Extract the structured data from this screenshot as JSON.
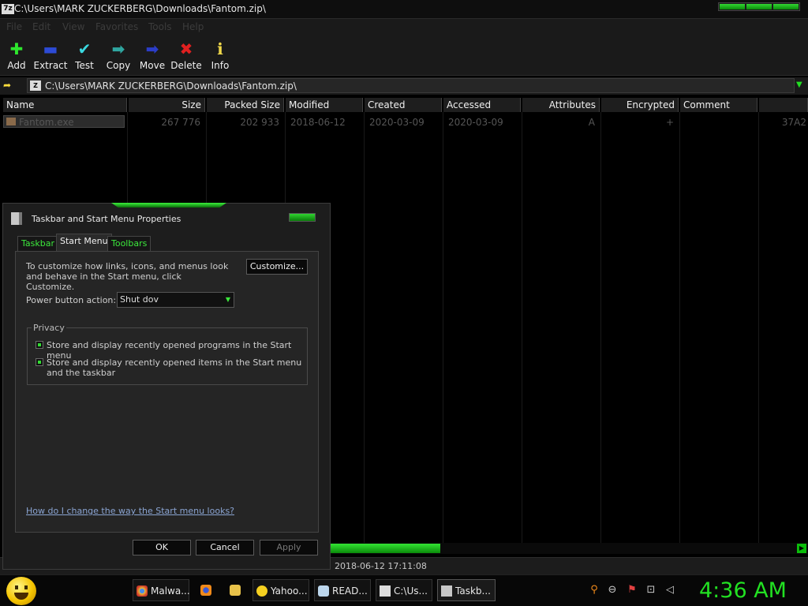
{
  "window": {
    "app_icon_text": "7z",
    "title": "C:\\Users\\MARK ZUCKERBERG\\Downloads\\Fantom.zip\\"
  },
  "menu": [
    "File",
    "Edit",
    "View",
    "Favorites",
    "Tools",
    "Help"
  ],
  "toolbar": {
    "add": "Add",
    "extract": "Extract",
    "test": "Test",
    "copy": "Copy",
    "move": "Move",
    "delete": "Delete",
    "info": "Info"
  },
  "address": {
    "zip_icon_text": "Z",
    "path": "C:\\Users\\MARK ZUCKERBERG\\Downloads\\Fantom.zip\\"
  },
  "columns": [
    "Name",
    "Size",
    "Packed Size",
    "Modified",
    "Created",
    "Accessed",
    "Attributes",
    "Encrypted",
    "Comment"
  ],
  "files": [
    {
      "name": "Fantom.exe",
      "size": "267 776",
      "packed_size": "202 933",
      "modified": "2018-06-12",
      "created": "2020-03-09",
      "accessed": "2020-03-09",
      "attributes": "A",
      "encrypted": "+",
      "comment": "",
      "crc": "37A2"
    }
  ],
  "status": {
    "modified_time": "2018-06-12 17:11:08"
  },
  "dialog": {
    "title": "Taskbar and Start Menu Properties",
    "tabs": [
      "Taskbar",
      "Start Menu",
      "Toolbars"
    ],
    "active_tab": "Start Menu",
    "description": "To customize how links, icons, and menus look and behave in the Start menu, click Customize.",
    "customize_button": "Customize...",
    "power_label": "Power button action:",
    "power_value": "Shut dov",
    "privacy_label": "Privacy",
    "privacy_options": [
      {
        "label": "Store and display recently opened programs in the Start menu",
        "checked": true
      },
      {
        "label": "Store and display recently opened items in the Start menu and the taskbar",
        "checked": true
      }
    ],
    "help_link": "How do I change the way the Start menu looks?",
    "ok": "OK",
    "cancel": "Cancel",
    "apply": "Apply"
  },
  "taskbar": {
    "tasks": [
      {
        "label": "Malwa...",
        "icon": "chrome-icon"
      },
      {
        "label": "",
        "icon": "firefox-icon"
      },
      {
        "label": "",
        "icon": "folder-icon"
      },
      {
        "label": "Yahoo...",
        "icon": "yahoo-messenger-icon"
      },
      {
        "label": "READ...",
        "icon": "notepad-icon"
      },
      {
        "label": "C:\\Us...",
        "icon": "7zip-icon"
      },
      {
        "label": "Taskb...",
        "icon": "taskbar-properties-icon"
      }
    ],
    "tray_icons": [
      "search-icon",
      "messenger-icon",
      "action-center-flag-icon",
      "network-icon",
      "volume-icon"
    ],
    "clock": "4:36 AM"
  },
  "colors": {
    "accent_green": "#22e022",
    "background": "#000000",
    "link": "#8aa4d2"
  }
}
